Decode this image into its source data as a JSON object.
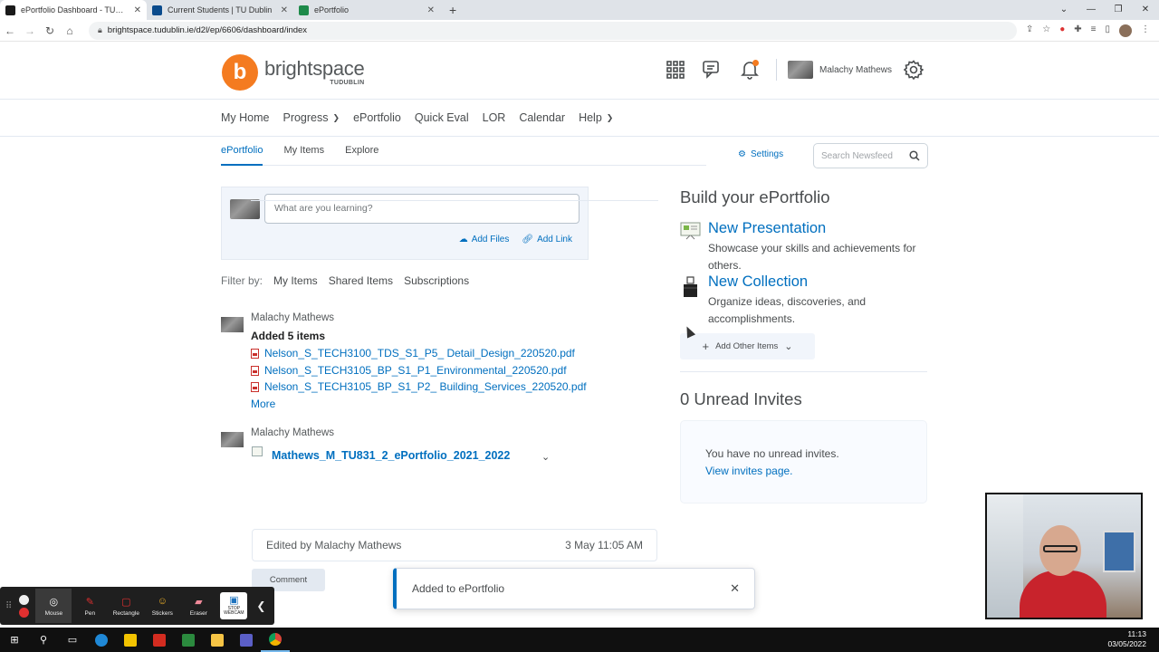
{
  "browser": {
    "tabs": [
      {
        "title": "ePortfolio Dashboard - TUDublin",
        "active": true,
        "favicon_color": "#1a1a1a"
      },
      {
        "title": "Current Students | TU Dublin",
        "active": false,
        "favicon_color": "#0a4b8c"
      },
      {
        "title": "ePortfolio",
        "active": false,
        "favicon_color": "#1e8a4a"
      }
    ],
    "url": "brightspace.tudublin.ie/d2l/ep/6606/dashboard/index"
  },
  "header": {
    "logo_letter": "b",
    "logo_name": "brightspace",
    "logo_sub": "TUDUBLIN",
    "user_name": "Malachy Mathews"
  },
  "navbar": {
    "items": [
      {
        "label": "My Home",
        "dropdown": false
      },
      {
        "label": "Progress",
        "dropdown": true
      },
      {
        "label": "ePortfolio",
        "dropdown": false
      },
      {
        "label": "Quick Eval",
        "dropdown": false
      },
      {
        "label": "LOR",
        "dropdown": false
      },
      {
        "label": "Calendar",
        "dropdown": false
      },
      {
        "label": "Help",
        "dropdown": true
      }
    ]
  },
  "subtabs": [
    {
      "label": "ePortfolio",
      "active": true
    },
    {
      "label": "My Items",
      "active": false
    },
    {
      "label": "Explore",
      "active": false
    }
  ],
  "settings_label": "Settings",
  "search": {
    "placeholder": "Search Newsfeed"
  },
  "composer": {
    "placeholder": "What are you learning?",
    "add_files": "Add Files",
    "add_link": "Add Link"
  },
  "filter": {
    "label": "Filter by:",
    "options": [
      "My Items",
      "Shared Items",
      "Subscriptions"
    ]
  },
  "feed": {
    "item1": {
      "author": "Malachy Mathews",
      "action": "Added 5 items",
      "files": [
        "Nelson_S_TECH3100_TDS_S1_P5_ Detail_Design_220520.pdf",
        "Nelson_S_TECH3105_BP_S1_P1_Environmental_220520.pdf",
        "Nelson_S_TECH3105_BP_S1_P2_ Building_Services_220520.pdf"
      ],
      "more": "More"
    },
    "item2": {
      "author": "Malachy Mathews",
      "presentation": "Mathews_M_TU831_2_ePortfolio_2021_2022"
    },
    "edited": {
      "text": "Edited by Malachy Mathews",
      "date": "3 May 11:05 AM"
    },
    "comment_label": "Comment"
  },
  "build": {
    "title": "Build your ePortfolio",
    "presentation": {
      "title": "New Presentation",
      "desc": "Showcase your skills and achievements for others."
    },
    "collection": {
      "title": "New Collection",
      "desc": "Organize ideas, discoveries, and accomplishments."
    },
    "add_other": "Add Other Items"
  },
  "invites": {
    "title": "0 Unread Invites",
    "message": "You have no unread invites.",
    "link": "View invites page."
  },
  "toast": {
    "message": "Added to ePortfolio"
  },
  "recorder": {
    "tools": [
      {
        "label": "Mouse",
        "icon": "mouse-icon",
        "glyph": "◎",
        "color": "#ffffff"
      },
      {
        "label": "Pen",
        "icon": "pen-icon",
        "glyph": "✎",
        "color": "#e03030"
      },
      {
        "label": "Rectangle",
        "icon": "rectangle-icon",
        "glyph": "▢",
        "color": "#e03030"
      },
      {
        "label": "Stickers",
        "icon": "sticker-icon",
        "glyph": "☺",
        "color": "#f2b428"
      },
      {
        "label": "Eraser",
        "icon": "eraser-icon",
        "glyph": "▰",
        "color": "#f08a9a"
      }
    ],
    "webcam_label": "STOP WEBCAM"
  },
  "taskbar": {
    "time": "11:13",
    "date": "03/05/2022"
  }
}
